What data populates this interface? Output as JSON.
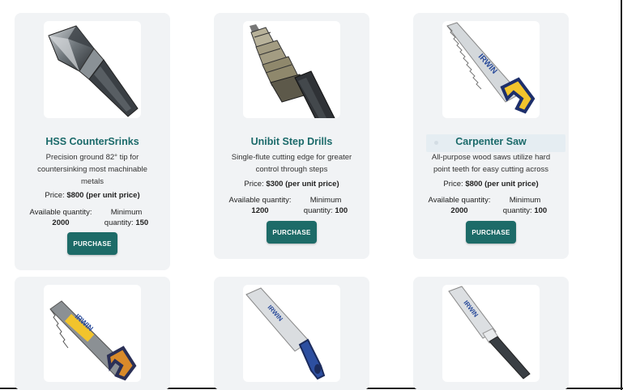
{
  "products": [
    {
      "title": "HSS CounterSrinks",
      "description": "Precision ground 82° tip for countersinking most machinable metals",
      "price_label": "Price: ",
      "price_value": "$800 (per unit price)",
      "available_label": "Available quantity:",
      "available_value": "2000",
      "minimum_label": "Minimum quantity: ",
      "minimum_value": "150",
      "button_label": "PURCHASE",
      "image_icon": "countersink-bit-icon"
    },
    {
      "title": "Unibit Step Drills",
      "description": "Single-flute cutting edge for greater control through steps",
      "price_label": "Price: ",
      "price_value": "$300 (per unit price)",
      "available_label": "Available quantity:",
      "available_value": "1200",
      "minimum_label": "Minimum quantity: ",
      "minimum_value": "100",
      "button_label": "PURCHASE",
      "image_icon": "step-drill-icon"
    },
    {
      "title": "Carpenter Saw",
      "description": "All-purpose wood saws utilize hard point teeth for easy cutting across",
      "price_label": "Price: ",
      "price_value": "$800 (per unit price)",
      "available_label": "Available quantity:",
      "available_value": "2000",
      "minimum_label": "Minimum quantity: ",
      "minimum_value": "100",
      "button_label": "PURCHASE",
      "image_icon": "hand-saw-icon"
    },
    {
      "image_icon": "irwin-hand-saw-icon"
    },
    {
      "image_icon": "pull-saw-icon"
    },
    {
      "image_icon": "flush-cut-saw-icon"
    }
  ],
  "brand_text": "IRWIN",
  "colors": {
    "accent": "#1d6b68",
    "title": "#1b6a6a",
    "card": "#f1f3f5"
  }
}
